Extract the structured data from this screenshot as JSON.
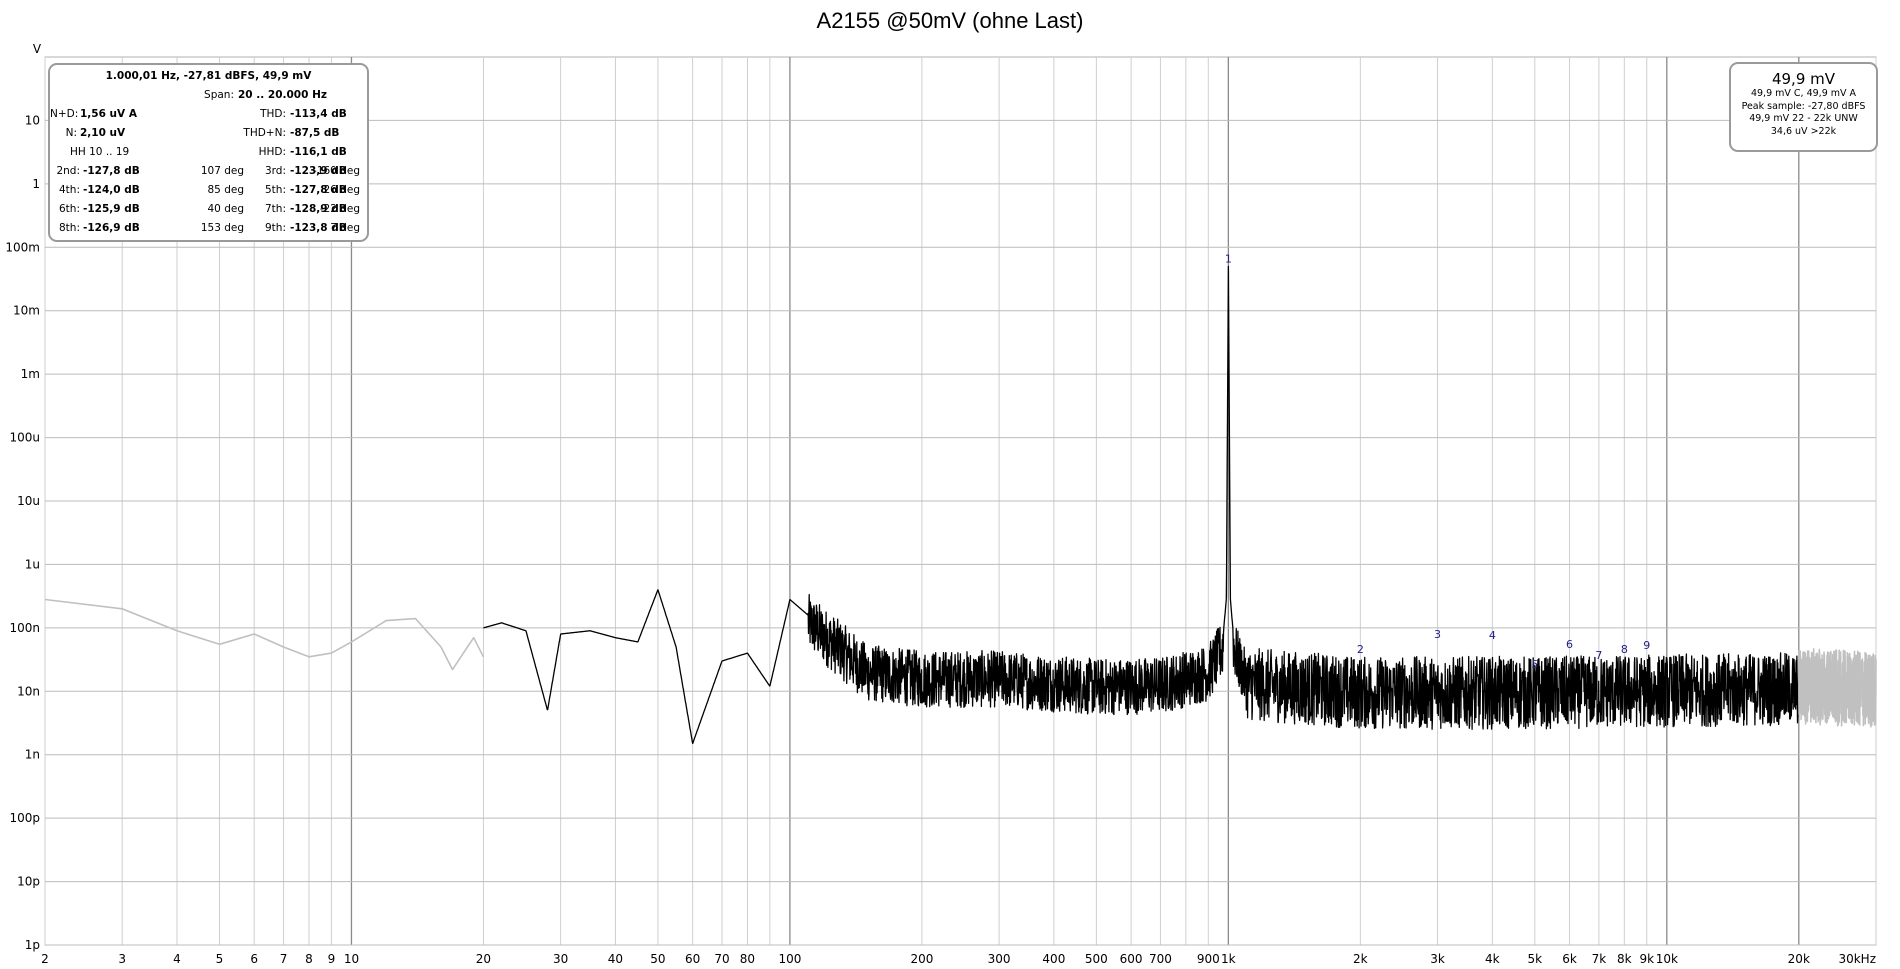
{
  "chart_data": {
    "type": "line",
    "title": "A2155 @50mV (ohne Last)",
    "ylabel": "V",
    "xlabel": "",
    "x_scale": "log",
    "y_scale": "log",
    "xlim": [
      2,
      30000
    ],
    "ylim": [
      1e-12,
      100
    ],
    "grid": true,
    "x_tick_labels": [
      "2",
      "3",
      "4",
      "5",
      "6",
      "7",
      "8",
      "9",
      "10",
      "20",
      "30",
      "40",
      "50",
      "60",
      "70",
      "80",
      "100",
      "200",
      "300",
      "400",
      "500",
      "600",
      "700",
      "900",
      "1k",
      "2k",
      "3k",
      "4k",
      "5k",
      "6k",
      "7k",
      "8k",
      "9k",
      "10k",
      "20k",
      "30kHz"
    ],
    "x_tick_values": [
      2,
      3,
      4,
      5,
      6,
      7,
      8,
      9,
      10,
      20,
      30,
      40,
      50,
      60,
      70,
      80,
      100,
      200,
      300,
      400,
      500,
      600,
      700,
      900,
      1000,
      2000,
      3000,
      4000,
      5000,
      6000,
      7000,
      8000,
      9000,
      10000,
      20000,
      30000
    ],
    "y_tick_labels": [
      "10",
      "1",
      "100m",
      "10m",
      "1m",
      "100u",
      "10u",
      "1u",
      "100n",
      "10n",
      "1n",
      "100p",
      "10p",
      "1p"
    ],
    "y_tick_values": [
      10,
      1,
      0.1,
      0.01,
      0.001,
      0.0001,
      1e-05,
      1e-06,
      1e-07,
      1e-08,
      1e-09,
      1e-10,
      1e-11,
      1e-12
    ],
    "series": [
      {
        "color": "#000000",
        "description_points": [
          [
            20,
            1e-07
          ],
          [
            22,
            1.2e-07
          ],
          [
            25,
            9e-08
          ],
          [
            28,
            5e-09
          ],
          [
            30,
            8e-08
          ],
          [
            35,
            9e-08
          ],
          [
            40,
            7e-08
          ],
          [
            45,
            6e-08
          ],
          [
            50,
            4e-07
          ],
          [
            55,
            5e-08
          ],
          [
            60,
            1.5e-09
          ],
          [
            70,
            3e-08
          ],
          [
            80,
            4e-08
          ],
          [
            90,
            1.2e-08
          ],
          [
            100,
            2.8e-07
          ],
          [
            150,
            2.5e-08
          ],
          [
            200,
            2e-08
          ],
          [
            300,
            2e-08
          ],
          [
            500,
            1.5e-08
          ],
          [
            700,
            1.6e-08
          ],
          [
            900,
            2.5e-08
          ],
          [
            970,
            6e-08
          ],
          [
            990,
            3e-07
          ],
          [
            1000,
            0.0499
          ],
          [
            1010,
            3e-07
          ],
          [
            1030,
            6e-08
          ],
          [
            1100,
            1.8e-08
          ],
          [
            2000,
            1.3e-08
          ],
          [
            5000,
            1.3e-08
          ],
          [
            10000,
            1.4e-08
          ],
          [
            20000,
            1.5e-08
          ]
        ]
      },
      {
        "color": "#c0c0c0",
        "description_points": [
          [
            2,
            2.8e-07
          ],
          [
            3,
            2e-07
          ],
          [
            4,
            9e-08
          ],
          [
            5,
            5.5e-08
          ],
          [
            6,
            8e-08
          ],
          [
            7,
            5e-08
          ],
          [
            8,
            3.5e-08
          ],
          [
            9,
            4e-08
          ],
          [
            10,
            6e-08
          ],
          [
            12,
            1.3e-07
          ],
          [
            14,
            1.4e-07
          ],
          [
            16,
            5e-08
          ],
          [
            17,
            2.2e-08
          ],
          [
            18,
            4e-08
          ],
          [
            19,
            7e-08
          ],
          [
            20,
            3.5e-08
          ]
        ]
      },
      {
        "color": "#c0c0c0",
        "description_points": [
          [
            20000,
            1.4e-08
          ],
          [
            30000,
            1.2e-08
          ]
        ]
      }
    ],
    "harmonic_markers": [
      {
        "label": "1",
        "x": 1000,
        "y": 0.0499
      },
      {
        "label": "2",
        "x": 2000,
        "y": 3.5e-08
      },
      {
        "label": "3",
        "x": 3000,
        "y": 6e-08
      },
      {
        "label": "4",
        "x": 4000,
        "y": 5.8e-08
      },
      {
        "label": "5",
        "x": 5000,
        "y": 2e-08
      },
      {
        "label": "6",
        "x": 6000,
        "y": 4.2e-08
      },
      {
        "label": "7",
        "x": 7000,
        "y": 2.8e-08
      },
      {
        "label": "8",
        "x": 8000,
        "y": 3.5e-08
      },
      {
        "label": "9",
        "x": 9000,
        "y": 4e-08
      }
    ]
  },
  "left_panel": {
    "header": "1.000,01 Hz, -27,81 dBFS, 49,9 mV",
    "span_label": "Span:",
    "span_value": "20 .. 20.000 Hz",
    "nd_label": "N+D:",
    "nd_value": "1,56 uV A",
    "thd_label": "THD:",
    "thd_value": "-113,4 dB",
    "n_label": "N:",
    "n_value": "2,10 uV",
    "thdn_label": "THD+N:",
    "thdn_value": "-87,5 dB",
    "hh_label": "HH 10 .. 19",
    "hhd_label": "HHD:",
    "hhd_value": "-116,1 dB",
    "harmonics": [
      {
        "l1": "2nd:",
        "v1": "-127,8 dB",
        "p1": "107 deg",
        "l2": "3rd:",
        "v2": "-123,9 dB",
        "p2": "-160 deg"
      },
      {
        "l1": "4th:",
        "v1": "-124,0 dB",
        "p1": "85 deg",
        "l2": "5th:",
        "v2": "-127,8 dB",
        "p2": "26 deg"
      },
      {
        "l1": "6th:",
        "v1": "-125,9 dB",
        "p1": "40 deg",
        "l2": "7th:",
        "v2": "-128,9 dB",
        "p2": "-22 deg"
      },
      {
        "l1": "8th:",
        "v1": "-126,9 dB",
        "p1": "153 deg",
        "l2": "9th:",
        "v2": "-123,8 dB",
        "p2": "7 deg"
      }
    ]
  },
  "right_panel": {
    "value": "49,9 mV",
    "line1": "49,9 mV C, 49,9 mV A",
    "line2": "Peak sample: -27,80 dBFS",
    "line3": "49,9 mV 22 - 22k UNW",
    "line4": "34,6 uV >22k"
  }
}
